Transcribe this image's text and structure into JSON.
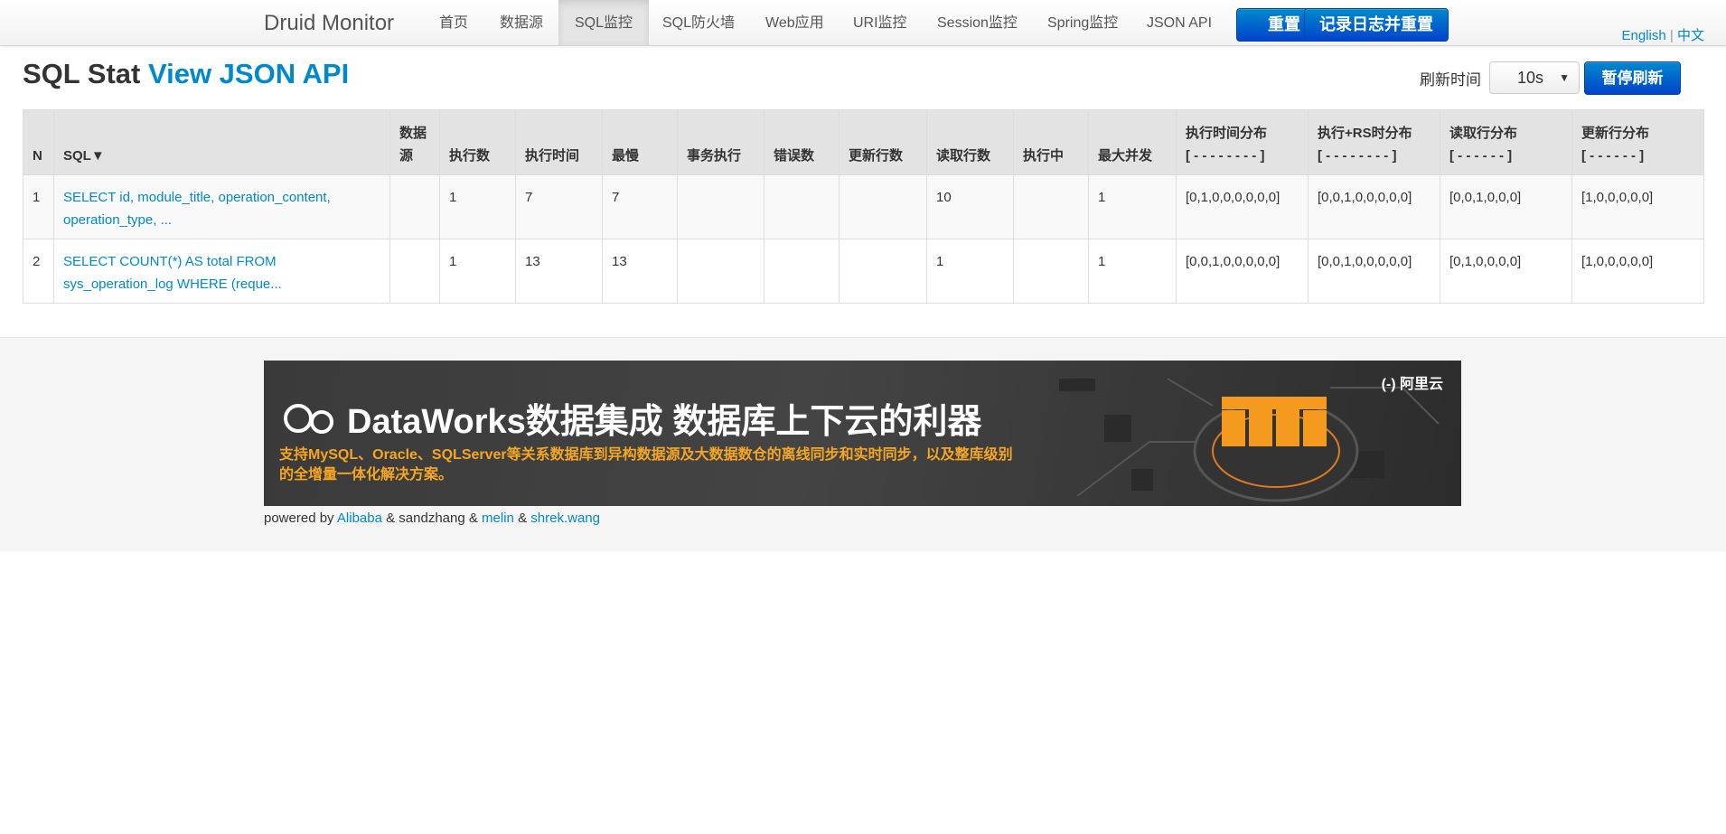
{
  "nav": {
    "brand": "Druid Monitor",
    "items": [
      {
        "label": "首页"
      },
      {
        "label": "数据源"
      },
      {
        "label": "SQL监控"
      },
      {
        "label": "SQL防火墙"
      },
      {
        "label": "Web应用"
      },
      {
        "label": "URI监控"
      },
      {
        "label": "Session监控"
      },
      {
        "label": "Spring监控"
      },
      {
        "label": "JSON API"
      }
    ],
    "reset_label": "重置",
    "log_reset_label": "记录日志并重置",
    "lang_en": "English",
    "lang_sep": "|",
    "lang_zh": "中文"
  },
  "header": {
    "title": "SQL Stat",
    "json_link": "View JSON API",
    "refresh_label": "刷新时间",
    "refresh_value": "10s",
    "pause_label": "暂停刷新"
  },
  "table": {
    "columns": [
      "N",
      "SQL▼",
      "数据源",
      "执行数",
      "执行时间",
      "最慢",
      "事务执行",
      "错误数",
      "更新行数",
      "读取行数",
      "执行中",
      "最大并发",
      "执行时间分布",
      "执行+RS时分布",
      "读取行分布",
      "更新行分布"
    ],
    "column_subs": [
      "",
      "",
      "",
      "",
      "",
      "",
      "",
      "",
      "",
      "",
      "",
      "",
      "[ - - - - - - - - ]",
      "[ - - - - - - - - ]",
      "[ - - - - - - ]",
      "[ - - - - - - ]"
    ],
    "rows": [
      {
        "n": "1",
        "sql": "SELECT id, module_title, operation_content, operation_type, ...",
        "datasource": "",
        "exec_count": "1",
        "exec_time": "7",
        "slowest": "7",
        "tx_exec": "",
        "errors": "",
        "update_rows": "",
        "read_rows": "10",
        "running": "",
        "max_concurrent": "1",
        "exec_hist": "[0,1,0,0,0,0,0,0]",
        "exec_rs_hist": "[0,0,1,0,0,0,0,0]",
        "read_hist": "[0,0,1,0,0,0]",
        "update_hist": "[1,0,0,0,0,0]"
      },
      {
        "n": "2",
        "sql": "SELECT COUNT(*) AS total FROM sys_operation_log WHERE (reque...",
        "datasource": "",
        "exec_count": "1",
        "exec_time": "13",
        "slowest": "13",
        "tx_exec": "",
        "errors": "",
        "update_rows": "",
        "read_rows": "1",
        "running": "",
        "max_concurrent": "1",
        "exec_hist": "[0,0,1,0,0,0,0,0]",
        "exec_rs_hist": "[0,0,1,0,0,0,0,0]",
        "read_hist": "[0,1,0,0,0,0]",
        "update_hist": "[1,0,0,0,0,0]"
      }
    ]
  },
  "footer": {
    "banner_title": "DataWorks数据集成 数据库上下云的利器",
    "banner_sub": "支持MySQL、Oracle、SQLServer等关系数据库到异构数据源及大数据数仓的离线同步和实时同步，以及整库级别的全增量一体化解决方案。",
    "banner_corner": "(-) 阿里云",
    "powered_prefix": "powered by",
    "alibaba": "Alibaba",
    "amp1": "& sandzhang &",
    "melin": "melin",
    "amp2": "&",
    "shrek": "shrek.wang"
  }
}
